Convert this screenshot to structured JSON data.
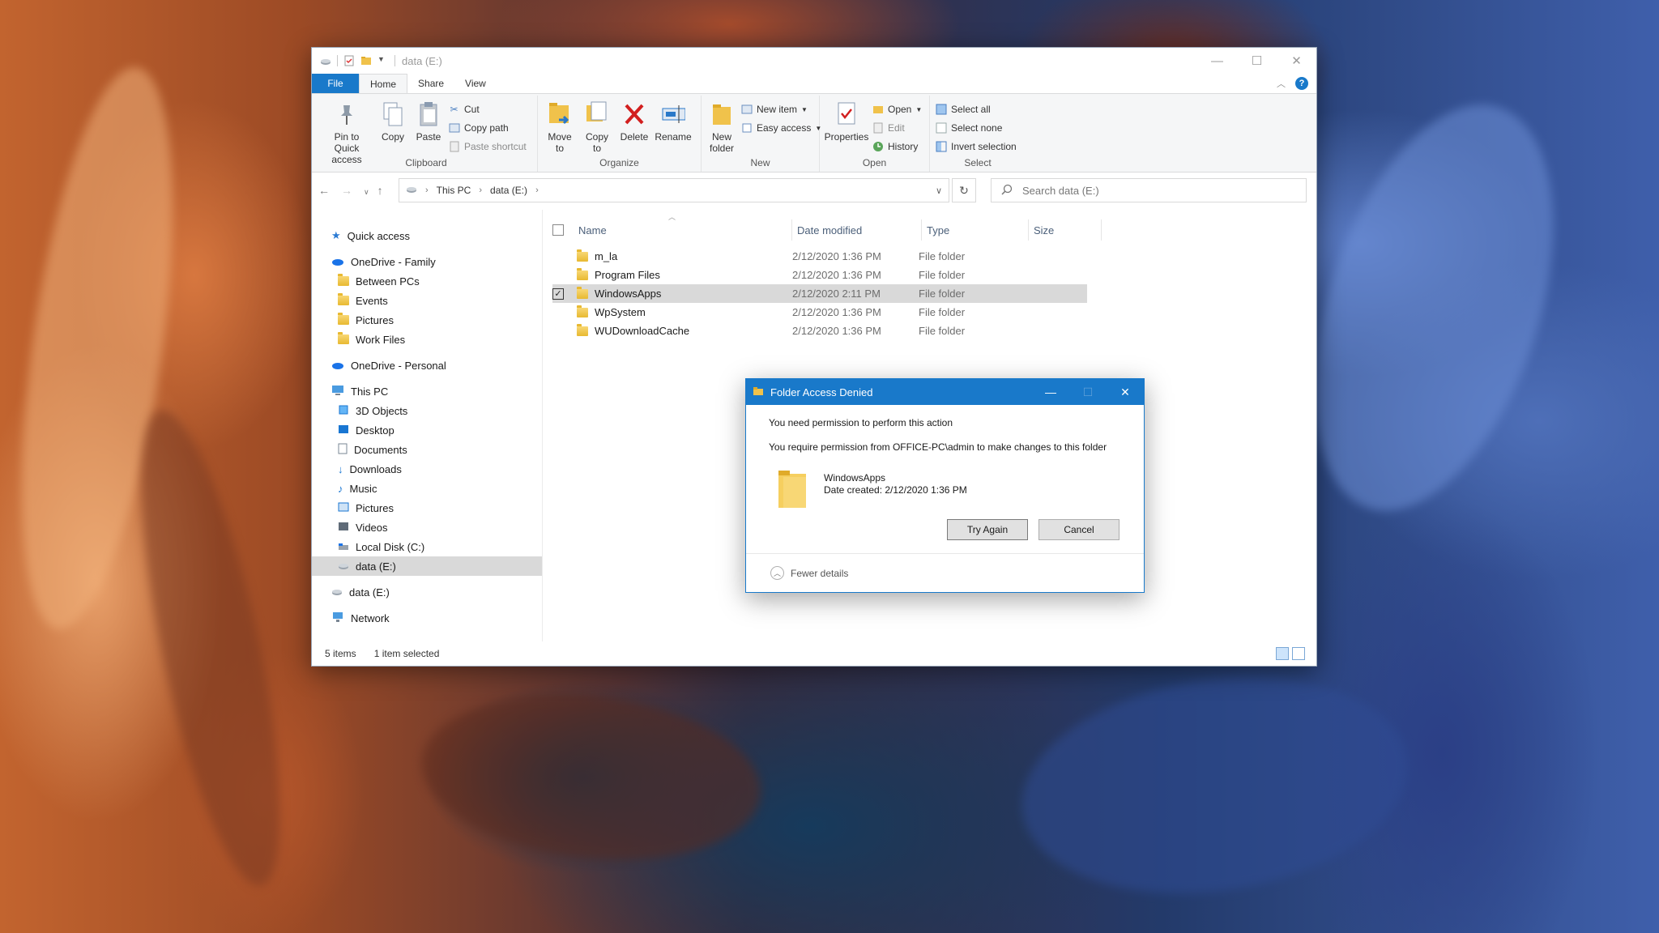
{
  "window": {
    "title": "data (E:)",
    "controls": [
      "—",
      "☐",
      "✕"
    ]
  },
  "tabs": [
    "File",
    "Home",
    "Share",
    "View"
  ],
  "ribbon": {
    "clipboard": {
      "label": "Clipboard",
      "pin": "Pin to Quick access",
      "copy": "Copy",
      "paste": "Paste",
      "cut": "Cut",
      "copy_path": "Copy path",
      "paste_shortcut": "Paste shortcut"
    },
    "organize": {
      "label": "Organize",
      "move_to": "Move to",
      "copy_to": "Copy to",
      "delete": "Delete",
      "rename": "Rename"
    },
    "new": {
      "label": "New",
      "new_folder": "New folder",
      "new_item": "New item",
      "easy_access": "Easy access"
    },
    "open": {
      "label": "Open",
      "properties": "Properties",
      "open": "Open",
      "edit": "Edit",
      "history": "History"
    },
    "select": {
      "label": "Select",
      "select_all": "Select all",
      "select_none": "Select none",
      "invert": "Invert selection"
    }
  },
  "address": {
    "crumbs": [
      "This PC",
      "data (E:)"
    ],
    "search_placeholder": "Search data (E:)"
  },
  "nav": {
    "quick_access": "Quick access",
    "onedrive_family": "OneDrive - Family",
    "family_items": [
      "Between PCs",
      "Events",
      "Pictures",
      "Work Files"
    ],
    "onedrive_personal": "OneDrive - Personal",
    "this_pc": "This PC",
    "pc_items": [
      "3D Objects",
      "Desktop",
      "Documents",
      "Downloads",
      "Music",
      "Pictures",
      "Videos",
      "Local Disk (C:)",
      "data (E:)"
    ],
    "data_e": "data (E:)",
    "network": "Network"
  },
  "columns": [
    "Name",
    "Date modified",
    "Type",
    "Size"
  ],
  "files": [
    {
      "name": "m_la",
      "date": "2/12/2020 1:36 PM",
      "type": "File folder"
    },
    {
      "name": "Program Files",
      "date": "2/12/2020 1:36 PM",
      "type": "File folder"
    },
    {
      "name": "WindowsApps",
      "date": "2/12/2020 2:11 PM",
      "type": "File folder"
    },
    {
      "name": "WpSystem",
      "date": "2/12/2020 1:36 PM",
      "type": "File folder"
    },
    {
      "name": "WUDownloadCache",
      "date": "2/12/2020 1:36 PM",
      "type": "File folder"
    }
  ],
  "status": {
    "count": "5 items",
    "selected": "1 item selected"
  },
  "dialog": {
    "title": "Folder Access Denied",
    "message1": "You need permission to perform this action",
    "message2": "You require permission from OFFICE-PC\\admin to make changes to this folder",
    "folder_name": "WindowsApps",
    "date_created": "Date created: 2/12/2020 1:36 PM",
    "try_again": "Try Again",
    "cancel": "Cancel",
    "fewer_details": "Fewer details"
  },
  "colors": {
    "accent": "#1979ca",
    "selection": "#d9d9d9",
    "folder": "#e8b931"
  }
}
